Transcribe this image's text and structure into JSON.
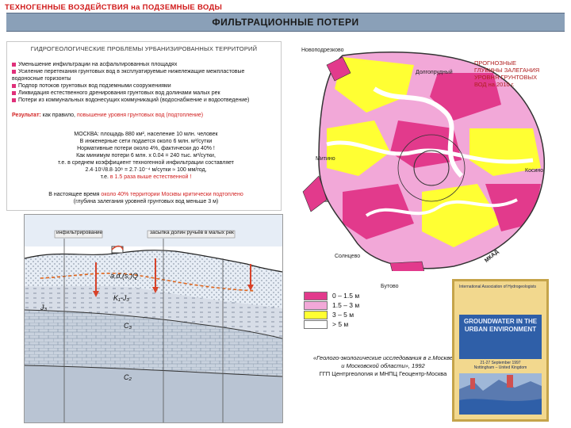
{
  "header": {
    "top_title": "ТЕХНОГЕННЫЕ ВОЗДЕЙСТВИЯ на ПОДЗЕМНЫЕ ВОДЫ",
    "banner_title": "ФИЛЬТРАЦИОННЫЕ ПОТЕРИ"
  },
  "panel": {
    "title": "ГИДРОГЕОЛОГИЧЕСКИЕ ПРОБЛЕМЫ УРБАНИЗИРОВАННЫХ ТЕРРИТОРИЙ",
    "bullets": [
      "Уменьшение инфильтрации на асфальтированных площадях",
      "Усиление перетекания грунтовых вод в эксплуатируемые нижележащие межпластовые водоносные горизонты",
      "Подпор потоков грунтовых вод подземными сооружениями",
      "Ликвидация естественного дренирования грунтовых вод долинами малых рек",
      "Потери из коммунальных водонесущих коммуникаций (водоснабжение и водоотведение)"
    ],
    "result_label": "Результат:",
    "result_text": "как правило,",
    "result_highlight": "повышение уровня грунтовых вод (подтопление)",
    "calc_lines": [
      "МОСКВА:  площадь 880 км², население 10 млн. человек",
      "В инженерные сети подается около 6 млн. м³/сутки",
      "Нормативные потери около 4%, фактически до 40% !",
      "Как минимум потери 6 млн. х 0.04 = 240 тыс. м³/сутки,",
      "т.е. в среднем коэффициент техногенной инфильтрации составляет",
      "2.4·10⁵/8.8·10⁸ = 2.7·10⁻⁴ м/сутки ≈ 100 мм/год,"
    ],
    "calc_last_prefix": "т.е.",
    "calc_last_highlight": "в 1.5 раза выше естественной !",
    "risk_prefix": "В настоящее время",
    "risk_highlight": "около 40% территории Москвы критически подтоплено",
    "risk_suffix": "(глубина залегания уровней грунтовых вод меньше 3 м)"
  },
  "section": {
    "label_infiltration": "инфильтрирование",
    "label_network": "засыпка долин ручьёв в малых рек",
    "aquifers": [
      "a,d,(s,)Q",
      "K₁-J₃",
      "J₃",
      "C₃",
      "C₂"
    ]
  },
  "map": {
    "places": [
      "Новоподрезково",
      "Долгопрудный",
      "Митино",
      "Косино",
      "Солнцево",
      "Бутово",
      "МКАД"
    ]
  },
  "forecast": {
    "line1": "ПРОГНОЗНЫЕ",
    "line2": "ГЛУБИНЫ ЗАЛЕГАНИЯ",
    "line3": "УРОВНЯ ГРУНТОВЫХ",
    "line4": "ВОД  на  2010 г."
  },
  "legend": [
    {
      "label": "0 – 1.5 м",
      "color": "#e23a8c"
    },
    {
      "label": "1.5 – 3 м",
      "color": "#f2a8d8"
    },
    {
      "label": "3 – 5 м",
      "color": "#ffff33"
    },
    {
      "label": "> 5 м",
      "color": "#ffffff"
    }
  ],
  "source": {
    "line1": "«Геолого-экологические исследования в г.Москве",
    "line2": "и Московской области», 1992",
    "line3": "ГГП Центргеология и МНПЦ Геоцентр-Москва"
  },
  "cover": {
    "header": "International Association of Hydrogeologists",
    "title1": "GROUNDWATER IN THE",
    "title2": "URBAN ENVIRONMENT",
    "dates": "21-27 September 1997",
    "place": "Nottingham – United Kingdom"
  }
}
